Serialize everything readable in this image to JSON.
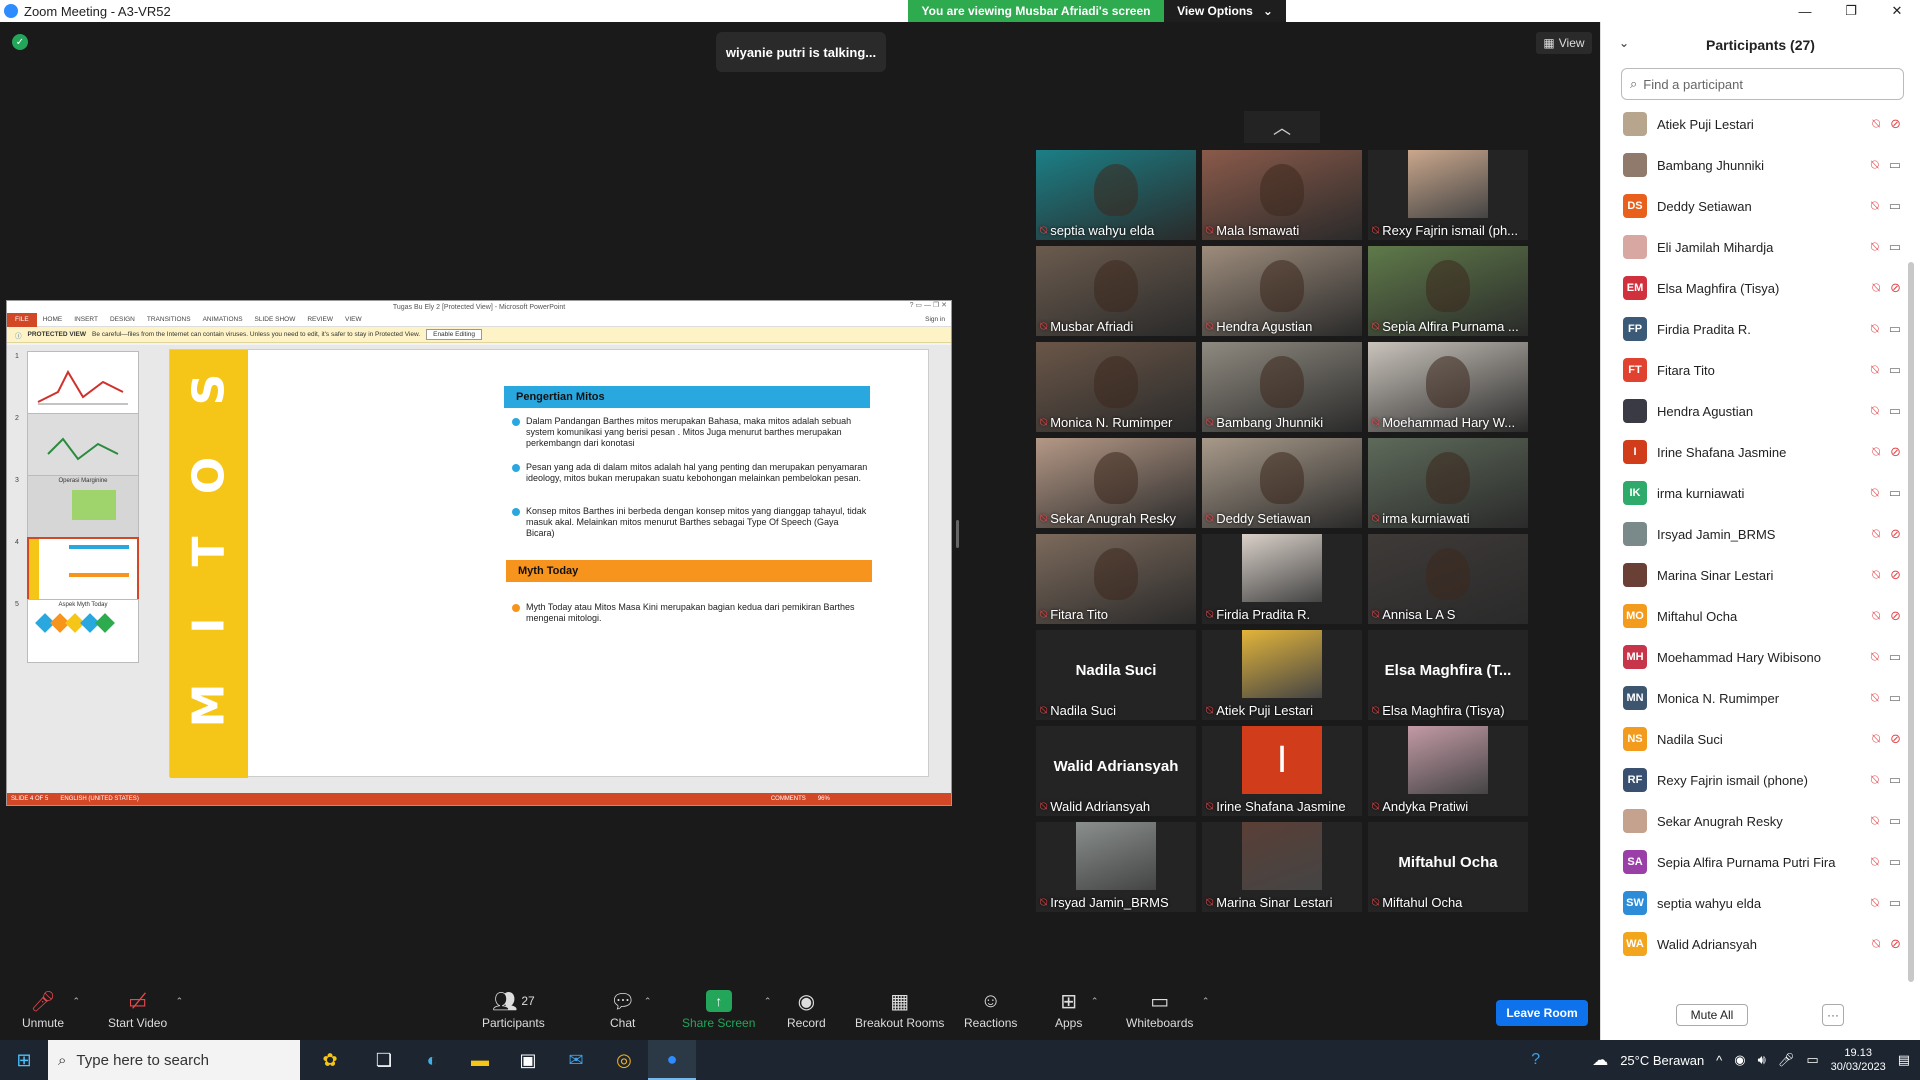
{
  "window": {
    "title": "Zoom Meeting - A3-VR52"
  },
  "banner": {
    "viewing": "You are viewing Musbar Afriadi's screen",
    "view_options": "View Options"
  },
  "meeting": {
    "talking": "wiyanie putri is talking...",
    "view_label": "View"
  },
  "ppt": {
    "title": "Tugas Bu Ely 2 [Protected View] - Microsoft PowerPoint",
    "ribbon_tabs": [
      "FILE",
      "HOME",
      "INSERT",
      "DESIGN",
      "TRANSITIONS",
      "ANIMATIONS",
      "SLIDE SHOW",
      "REVIEW",
      "VIEW"
    ],
    "sign_in": "Sign in",
    "protected_label": "PROTECTED VIEW",
    "protected_msg": "Be careful—files from the Internet can contain viruses. Unless you need to edit, it's safer to stay in Protected View.",
    "enable_editing": "Enable Editing",
    "thumbs": [
      {
        "num": "1",
        "label": ""
      },
      {
        "num": "2",
        "label": ""
      },
      {
        "num": "3",
        "label": "Operasi Marginine"
      },
      {
        "num": "4",
        "label": ""
      },
      {
        "num": "5",
        "label": "Aspek Myth Today"
      }
    ],
    "slide": {
      "vertical_text": [
        "S",
        "O",
        "T",
        "I",
        "M"
      ],
      "heading1": "Pengertian Mitos",
      "bullets1": [
        "Dalam Pandangan Barthes  mitos merupakan Bahasa, maka mitos adalah sebuah system komunikasi yang berisi pesan . Mitos Juga menurut barthes merupakan perkembangn dari konotasi",
        "Pesan yang ada di dalam mitos adalah hal yang penting dan merupakan penyamaran ideology, mitos bukan merupakan suatu kebohongan melainkan pembelokan pesan.",
        "Konsep mitos Barthes ini berbeda dengan konsep  mitos yang dianggap tahayul, tidak masuk akal. Melainkan mitos menurut Barthes sebagai Type Of Speech (Gaya Bicara)"
      ],
      "heading2": "Myth Today",
      "bullets2": [
        "Myth Today atau Mitos Masa Kini merupakan bagian kedua  dari pemikiran Barthes mengenai mitologi."
      ]
    },
    "status_slide": "SLIDE 4 OF 5",
    "status_lang": "ENGLISH (UNITED STATES)",
    "status_comments": "COMMENTS",
    "status_zoom": "96%"
  },
  "tiles": [
    {
      "name": "septia wahyu elda",
      "kind": "photo",
      "color": "#1b7f86"
    },
    {
      "name": "Mala Ismawati",
      "kind": "photo",
      "color": "#8a5a4a"
    },
    {
      "name": "Rexy Fajrin ismail (ph...",
      "kind": "photo-small",
      "color": "#caa78c"
    },
    {
      "name": "Musbar Afriadi",
      "kind": "photo",
      "color": "#6b5b4e"
    },
    {
      "name": "Hendra Agustian",
      "kind": "photo",
      "color": "#9d8c7c"
    },
    {
      "name": "Sepia Alfira Purnama ...",
      "kind": "photo",
      "color": "#5f7a4a"
    },
    {
      "name": "Monica N. Rumimper",
      "kind": "photo",
      "color": "#6a5648"
    },
    {
      "name": "Bambang Jhunniki",
      "kind": "photo",
      "color": "#8f8a80"
    },
    {
      "name": "Moehammad Hary W...",
      "kind": "photo",
      "color": "#c9c3bb"
    },
    {
      "name": "Sekar Anugrah Resky",
      "kind": "photo",
      "color": "#b49886"
    },
    {
      "name": "Deddy Setiawan",
      "kind": "photo",
      "color": "#a89a8a"
    },
    {
      "name": "irma kurniawati",
      "kind": "photo",
      "color": "#5e6a5a"
    },
    {
      "name": "Fitara Tito",
      "kind": "photo",
      "color": "#7c6a5c"
    },
    {
      "name": "Firdia Pradita R.",
      "kind": "photo-small",
      "color": "#d9d0c8"
    },
    {
      "name": "Annisa L A S",
      "kind": "photo",
      "color": "#3e3a38"
    },
    {
      "name": "Nadila Suci",
      "kind": "text",
      "big": "Nadila Suci"
    },
    {
      "name": "Atiek Puji Lestari",
      "kind": "photo-small",
      "color": "#e2b43a"
    },
    {
      "name": "Elsa Maghfira (Tisya)",
      "kind": "text",
      "big": "Elsa Maghfira (T..."
    },
    {
      "name": "Walid Adriansyah",
      "kind": "text",
      "big": "Walid Adriansyah"
    },
    {
      "name": "Irine Shafana Jasmine",
      "kind": "letter",
      "letter": "I",
      "color": "#d13d1b"
    },
    {
      "name": "Andyka Pratiwi",
      "kind": "photo-small",
      "color": "#c39aa6"
    },
    {
      "name": "Irsyad Jamin_BRMS",
      "kind": "photo-small",
      "color": "#8a8f8e"
    },
    {
      "name": "Marina Sinar Lestari",
      "kind": "photo-small",
      "color": "#5a3f36"
    },
    {
      "name": "Miftahul Ocha",
      "kind": "text",
      "big": "Miftahul Ocha"
    }
  ],
  "participants": {
    "title": "Participants (27)",
    "search_placeholder": "Find a participant",
    "list": [
      {
        "name": "Atiek Puji Lestari",
        "initials": "",
        "color": "#b8a58e",
        "video_off": true
      },
      {
        "name": "Bambang Jhunniki",
        "initials": "",
        "color": "#8f7a6c",
        "video_off": false
      },
      {
        "name": "Deddy Setiawan",
        "initials": "DS",
        "color": "#e8601c",
        "video_off": false
      },
      {
        "name": "Eli Jamilah Mihardja",
        "initials": "",
        "color": "#d8a7a2",
        "video_off": false
      },
      {
        "name": "Elsa Maghfira (Tisya)",
        "initials": "EM",
        "color": "#d1313d",
        "video_off": true
      },
      {
        "name": "Firdia Pradita R.",
        "initials": "FP",
        "color": "#3a5a78",
        "video_off": false
      },
      {
        "name": "Fitara Tito",
        "initials": "FT",
        "color": "#e0422f",
        "video_off": false
      },
      {
        "name": "Hendra Agustian",
        "initials": "",
        "color": "#3a3a44",
        "video_off": false
      },
      {
        "name": "Irine Shafana Jasmine",
        "initials": "I",
        "color": "#d13d1b",
        "video_off": true
      },
      {
        "name": "irma kurniawati",
        "initials": "IK",
        "color": "#2eaa6a",
        "video_off": false
      },
      {
        "name": "Irsyad Jamin_BRMS",
        "initials": "",
        "color": "#7a8a8a",
        "video_off": true
      },
      {
        "name": "Marina Sinar Lestari",
        "initials": "",
        "color": "#6a4036",
        "video_off": true
      },
      {
        "name": "Miftahul Ocha",
        "initials": "MO",
        "color": "#f29b1d",
        "video_off": true
      },
      {
        "name": "Moehammad Hary Wibisono",
        "initials": "MH",
        "color": "#c7354a",
        "video_off": false
      },
      {
        "name": "Monica N. Rumimper",
        "initials": "MN",
        "color": "#3e5570",
        "video_off": false
      },
      {
        "name": "Nadila Suci",
        "initials": "NS",
        "color": "#f29b1d",
        "video_off": true
      },
      {
        "name": "Rexy Fajrin ismail (phone)",
        "initials": "RF",
        "color": "#3a5070",
        "video_off": false
      },
      {
        "name": "Sekar Anugrah Resky",
        "initials": "",
        "color": "#c4a28e",
        "video_off": false
      },
      {
        "name": "Sepia Alfira Purnama Putri Fira",
        "initials": "SA",
        "color": "#9b3fa8",
        "video_off": false
      },
      {
        "name": "septia wahyu elda",
        "initials": "SW",
        "color": "#2d8cd8",
        "video_off": false
      },
      {
        "name": "Walid Adriansyah",
        "initials": "WA",
        "color": "#f2a51d",
        "video_off": true
      }
    ],
    "mute_all": "Mute All",
    "more": "···"
  },
  "toolbar": {
    "unmute": "Unmute",
    "start_video": "Start Video",
    "participants": "Participants",
    "participants_count": "27",
    "chat": "Chat",
    "share_screen": "Share Screen",
    "record": "Record",
    "breakout": "Breakout Rooms",
    "reactions": "Reactions",
    "apps": "Apps",
    "whiteboards": "Whiteboards",
    "leave": "Leave Room"
  },
  "taskbar": {
    "search_placeholder": "Type here to search",
    "weather": "25°C  Berawan",
    "time": "19.13",
    "date": "30/03/2023"
  }
}
